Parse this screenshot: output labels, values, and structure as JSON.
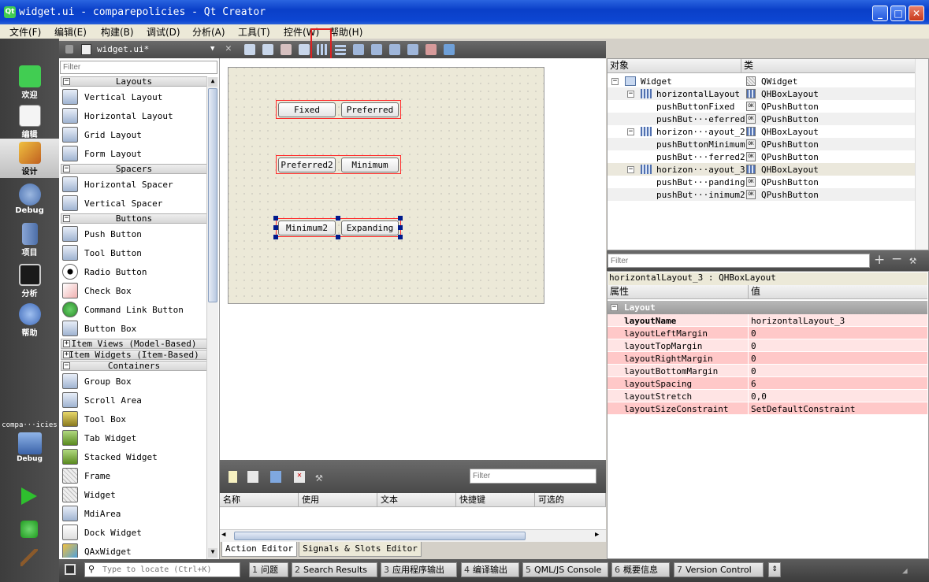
{
  "window": {
    "title": "widget.ui - comparepolicies - Qt Creator",
    "logo": "Qt",
    "buttons": {
      "minimize": "_",
      "maximize": "□",
      "close": "✕"
    }
  },
  "menu": [
    "文件(F)",
    "编辑(E)",
    "构建(B)",
    "调试(D)",
    "分析(A)",
    "工具(T)",
    "控件(W)",
    "帮助(H)"
  ],
  "modes": [
    {
      "label": "欢迎",
      "icon": "qt-welcome-icon"
    },
    {
      "label": "编辑",
      "icon": "edit-document-icon"
    },
    {
      "label": "设计",
      "icon": "design-pencil-icon"
    },
    {
      "label": "Debug",
      "icon": "debug-bug-icon"
    },
    {
      "label": "项目",
      "icon": "project-folder-icon"
    },
    {
      "label": "分析",
      "icon": "analyze-monitor-icon"
    },
    {
      "label": "帮助",
      "icon": "help-icon"
    }
  ],
  "target": {
    "project": "compa···icies",
    "config": "Debug"
  },
  "run_buttons": [
    "run-icon",
    "debug-run-icon",
    "build-hammer-icon"
  ],
  "editor": {
    "file": "widget.ui*"
  },
  "widget_box": {
    "filter_placeholder": "Filter",
    "categories": {
      "layouts": "Layouts",
      "spacers": "Spacers",
      "buttons": "Buttons",
      "item_views": "Item Views (Model-Based)",
      "item_widgets": "Item Widgets (Item-Based)",
      "containers": "Containers"
    },
    "layouts": [
      "Vertical Layout",
      "Horizontal Layout",
      "Grid Layout",
      "Form Layout"
    ],
    "spacers": [
      "Horizontal Spacer",
      "Vertical Spacer"
    ],
    "buttons": [
      "Push Button",
      "Tool Button",
      "Radio Button",
      "Check Box",
      "Command Link Button",
      "Button Box"
    ],
    "containers": [
      "Group Box",
      "Scroll Area",
      "Tool Box",
      "Tab Widget",
      "Stacked Widget",
      "Frame",
      "Widget",
      "MdiArea",
      "Dock Widget",
      "QAxWidget"
    ]
  },
  "form": {
    "row1": [
      "Fixed",
      "Preferred"
    ],
    "row2": [
      "Preferred2",
      "Minimum"
    ],
    "row3": [
      "Minimum2",
      "Expanding"
    ]
  },
  "action_editor": {
    "filter_placeholder": "Filter",
    "columns": [
      "名称",
      "使用",
      "文本",
      "快捷键",
      "可选的"
    ],
    "tabs": [
      "Action Editor",
      "Signals & Slots Editor"
    ]
  },
  "object_inspector": {
    "headers": [
      "对象",
      "类"
    ],
    "rows": [
      {
        "name": "Widget",
        "class": "QWidget"
      },
      {
        "name": "horizontalLayout",
        "class": "QHBoxLayout"
      },
      {
        "name": "pushButtonFixed",
        "class": "QPushButton"
      },
      {
        "name": "pushBut···eferred",
        "class": "QPushButton"
      },
      {
        "name": "horizon···ayout_2",
        "class": "QHBoxLayout"
      },
      {
        "name": "pushButtonMinimum",
        "class": "QPushButton"
      },
      {
        "name": "pushBut···ferred2",
        "class": "QPushButton"
      },
      {
        "name": "horizon···ayout_3",
        "class": "QHBoxLayout"
      },
      {
        "name": "pushBut···panding",
        "class": "QPushButton"
      },
      {
        "name": "pushBut···inimum2",
        "class": "QPushButton"
      }
    ]
  },
  "property_editor": {
    "filter_placeholder": "Filter",
    "current": "horizontalLayout_3 : QHBoxLayout",
    "headers": [
      "属性",
      "值"
    ],
    "section": "Layout",
    "rows": [
      {
        "name": "layoutName",
        "value": "horizontalLayout_3"
      },
      {
        "name": "layoutLeftMargin",
        "value": "0"
      },
      {
        "name": "layoutTopMargin",
        "value": "0"
      },
      {
        "name": "layoutRightMargin",
        "value": "0"
      },
      {
        "name": "layoutBottomMargin",
        "value": "0"
      },
      {
        "name": "layoutSpacing",
        "value": "6"
      },
      {
        "name": "layoutStretch",
        "value": "0,0"
      },
      {
        "name": "layoutSizeConstraint",
        "value": "SetDefaultConstraint"
      }
    ]
  },
  "statusbar": {
    "locate_placeholder": "Type to locate (Ctrl+K)",
    "panes": [
      {
        "num": "1",
        "label": "问题"
      },
      {
        "num": "2",
        "label": "Search Results"
      },
      {
        "num": "3",
        "label": "应用程序输出"
      },
      {
        "num": "4",
        "label": "编译输出"
      },
      {
        "num": "5",
        "label": "QML/JS Console"
      },
      {
        "num": "6",
        "label": "概要信息"
      },
      {
        "num": "7",
        "label": "Version Control"
      }
    ]
  },
  "colors": {
    "accent": "#0a3fc8",
    "layout_frame": "#ff2a2a",
    "selection_handle": "#001a8c",
    "modified_property": "#ffc8c8"
  }
}
